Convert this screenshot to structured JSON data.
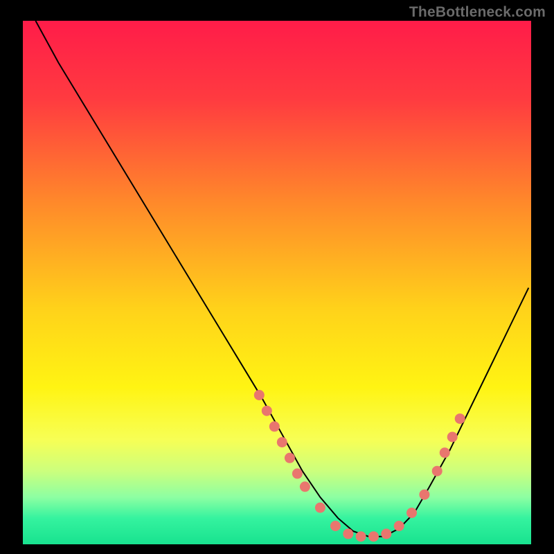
{
  "brand": {
    "watermark": "TheBottleneck.com"
  },
  "chart_data": {
    "type": "line",
    "title": "",
    "xlabel": "",
    "ylabel": "",
    "x_range": [
      0,
      100
    ],
    "y_range": [
      0,
      100
    ],
    "legend": false,
    "grid": false,
    "background": {
      "type": "vertical-gradient",
      "stops": [
        {
          "offset": 0.0,
          "color": "#ff1c49"
        },
        {
          "offset": 0.15,
          "color": "#ff3b40"
        },
        {
          "offset": 0.35,
          "color": "#ff8a2a"
        },
        {
          "offset": 0.55,
          "color": "#ffd21a"
        },
        {
          "offset": 0.7,
          "color": "#fff413"
        },
        {
          "offset": 0.8,
          "color": "#f7ff55"
        },
        {
          "offset": 0.86,
          "color": "#ccff7d"
        },
        {
          "offset": 0.91,
          "color": "#8dffa2"
        },
        {
          "offset": 0.95,
          "color": "#35f39f"
        },
        {
          "offset": 1.0,
          "color": "#18e28f"
        }
      ]
    },
    "series": [
      {
        "name": "bottleneck-curve",
        "x": [
          2.5,
          7,
          12,
          17,
          22,
          27,
          32,
          37,
          42,
          47,
          51,
          55,
          58.5,
          62,
          65,
          68,
          71,
          74,
          77,
          80,
          84,
          88,
          92,
          96,
          99.5
        ],
        "values": [
          100,
          92,
          84,
          76,
          68,
          60,
          52,
          44,
          36,
          28,
          21,
          14,
          9,
          5,
          2.5,
          1.5,
          1.5,
          3,
          6,
          11,
          18,
          26,
          34,
          42,
          49
        ]
      }
    ],
    "markers": {
      "name": "highlighted-points",
      "color": "#e9766e",
      "points": [
        {
          "x": 46.5,
          "y": 28.5
        },
        {
          "x": 48.0,
          "y": 25.5
        },
        {
          "x": 49.5,
          "y": 22.5
        },
        {
          "x": 51.0,
          "y": 19.5
        },
        {
          "x": 52.5,
          "y": 16.5
        },
        {
          "x": 54.0,
          "y": 13.5
        },
        {
          "x": 55.5,
          "y": 11.0
        },
        {
          "x": 58.5,
          "y": 7.0
        },
        {
          "x": 61.5,
          "y": 3.5
        },
        {
          "x": 64.0,
          "y": 2.0
        },
        {
          "x": 66.5,
          "y": 1.5
        },
        {
          "x": 69.0,
          "y": 1.5
        },
        {
          "x": 71.5,
          "y": 2.0
        },
        {
          "x": 74.0,
          "y": 3.5
        },
        {
          "x": 76.5,
          "y": 6.0
        },
        {
          "x": 79.0,
          "y": 9.5
        },
        {
          "x": 81.5,
          "y": 14.0
        },
        {
          "x": 83.0,
          "y": 17.5
        },
        {
          "x": 84.5,
          "y": 20.5
        },
        {
          "x": 86.0,
          "y": 24.0
        }
      ]
    }
  }
}
